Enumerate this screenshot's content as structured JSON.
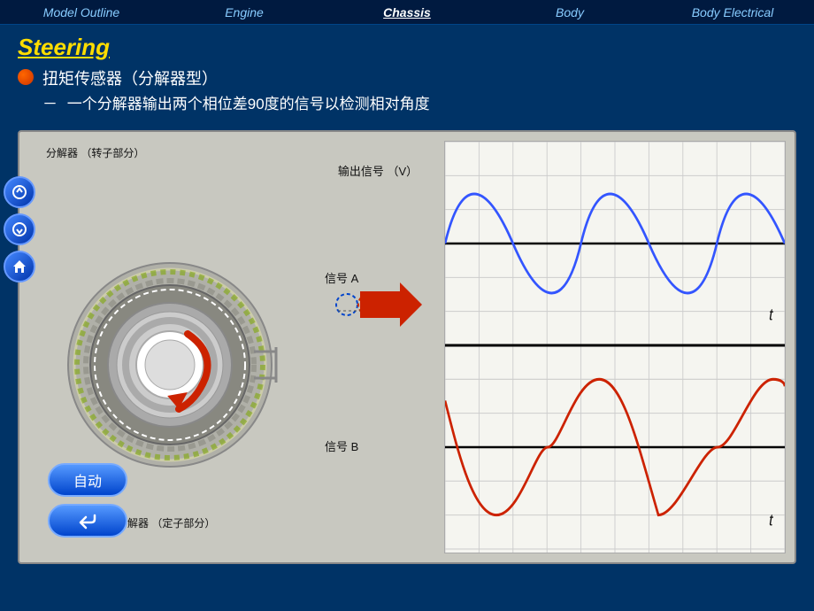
{
  "nav": {
    "items": [
      {
        "label": "Model Outline",
        "active": false
      },
      {
        "label": "Engine",
        "active": false
      },
      {
        "label": "Chassis",
        "active": true
      },
      {
        "label": "Body",
        "active": false
      },
      {
        "label": "Body Electrical",
        "active": false
      }
    ]
  },
  "page": {
    "title": "Steering"
  },
  "content": {
    "bullet_main": "扭矩传感器（分解器型）",
    "bullet_sub": "一个分解器输出两个相位差90度的信号以检测相对角度",
    "dash": "－"
  },
  "diagram": {
    "resolver_label_top": "分解器\n（转子部分）",
    "resolver_label_bottom": "分解器\n（定子部分）",
    "output_label": "输出信号\n（V）",
    "signal_a": "信号 A",
    "signal_b": "信号 B",
    "t_label": "t"
  },
  "buttons": {
    "auto": "自动",
    "back_icon": "↩"
  }
}
